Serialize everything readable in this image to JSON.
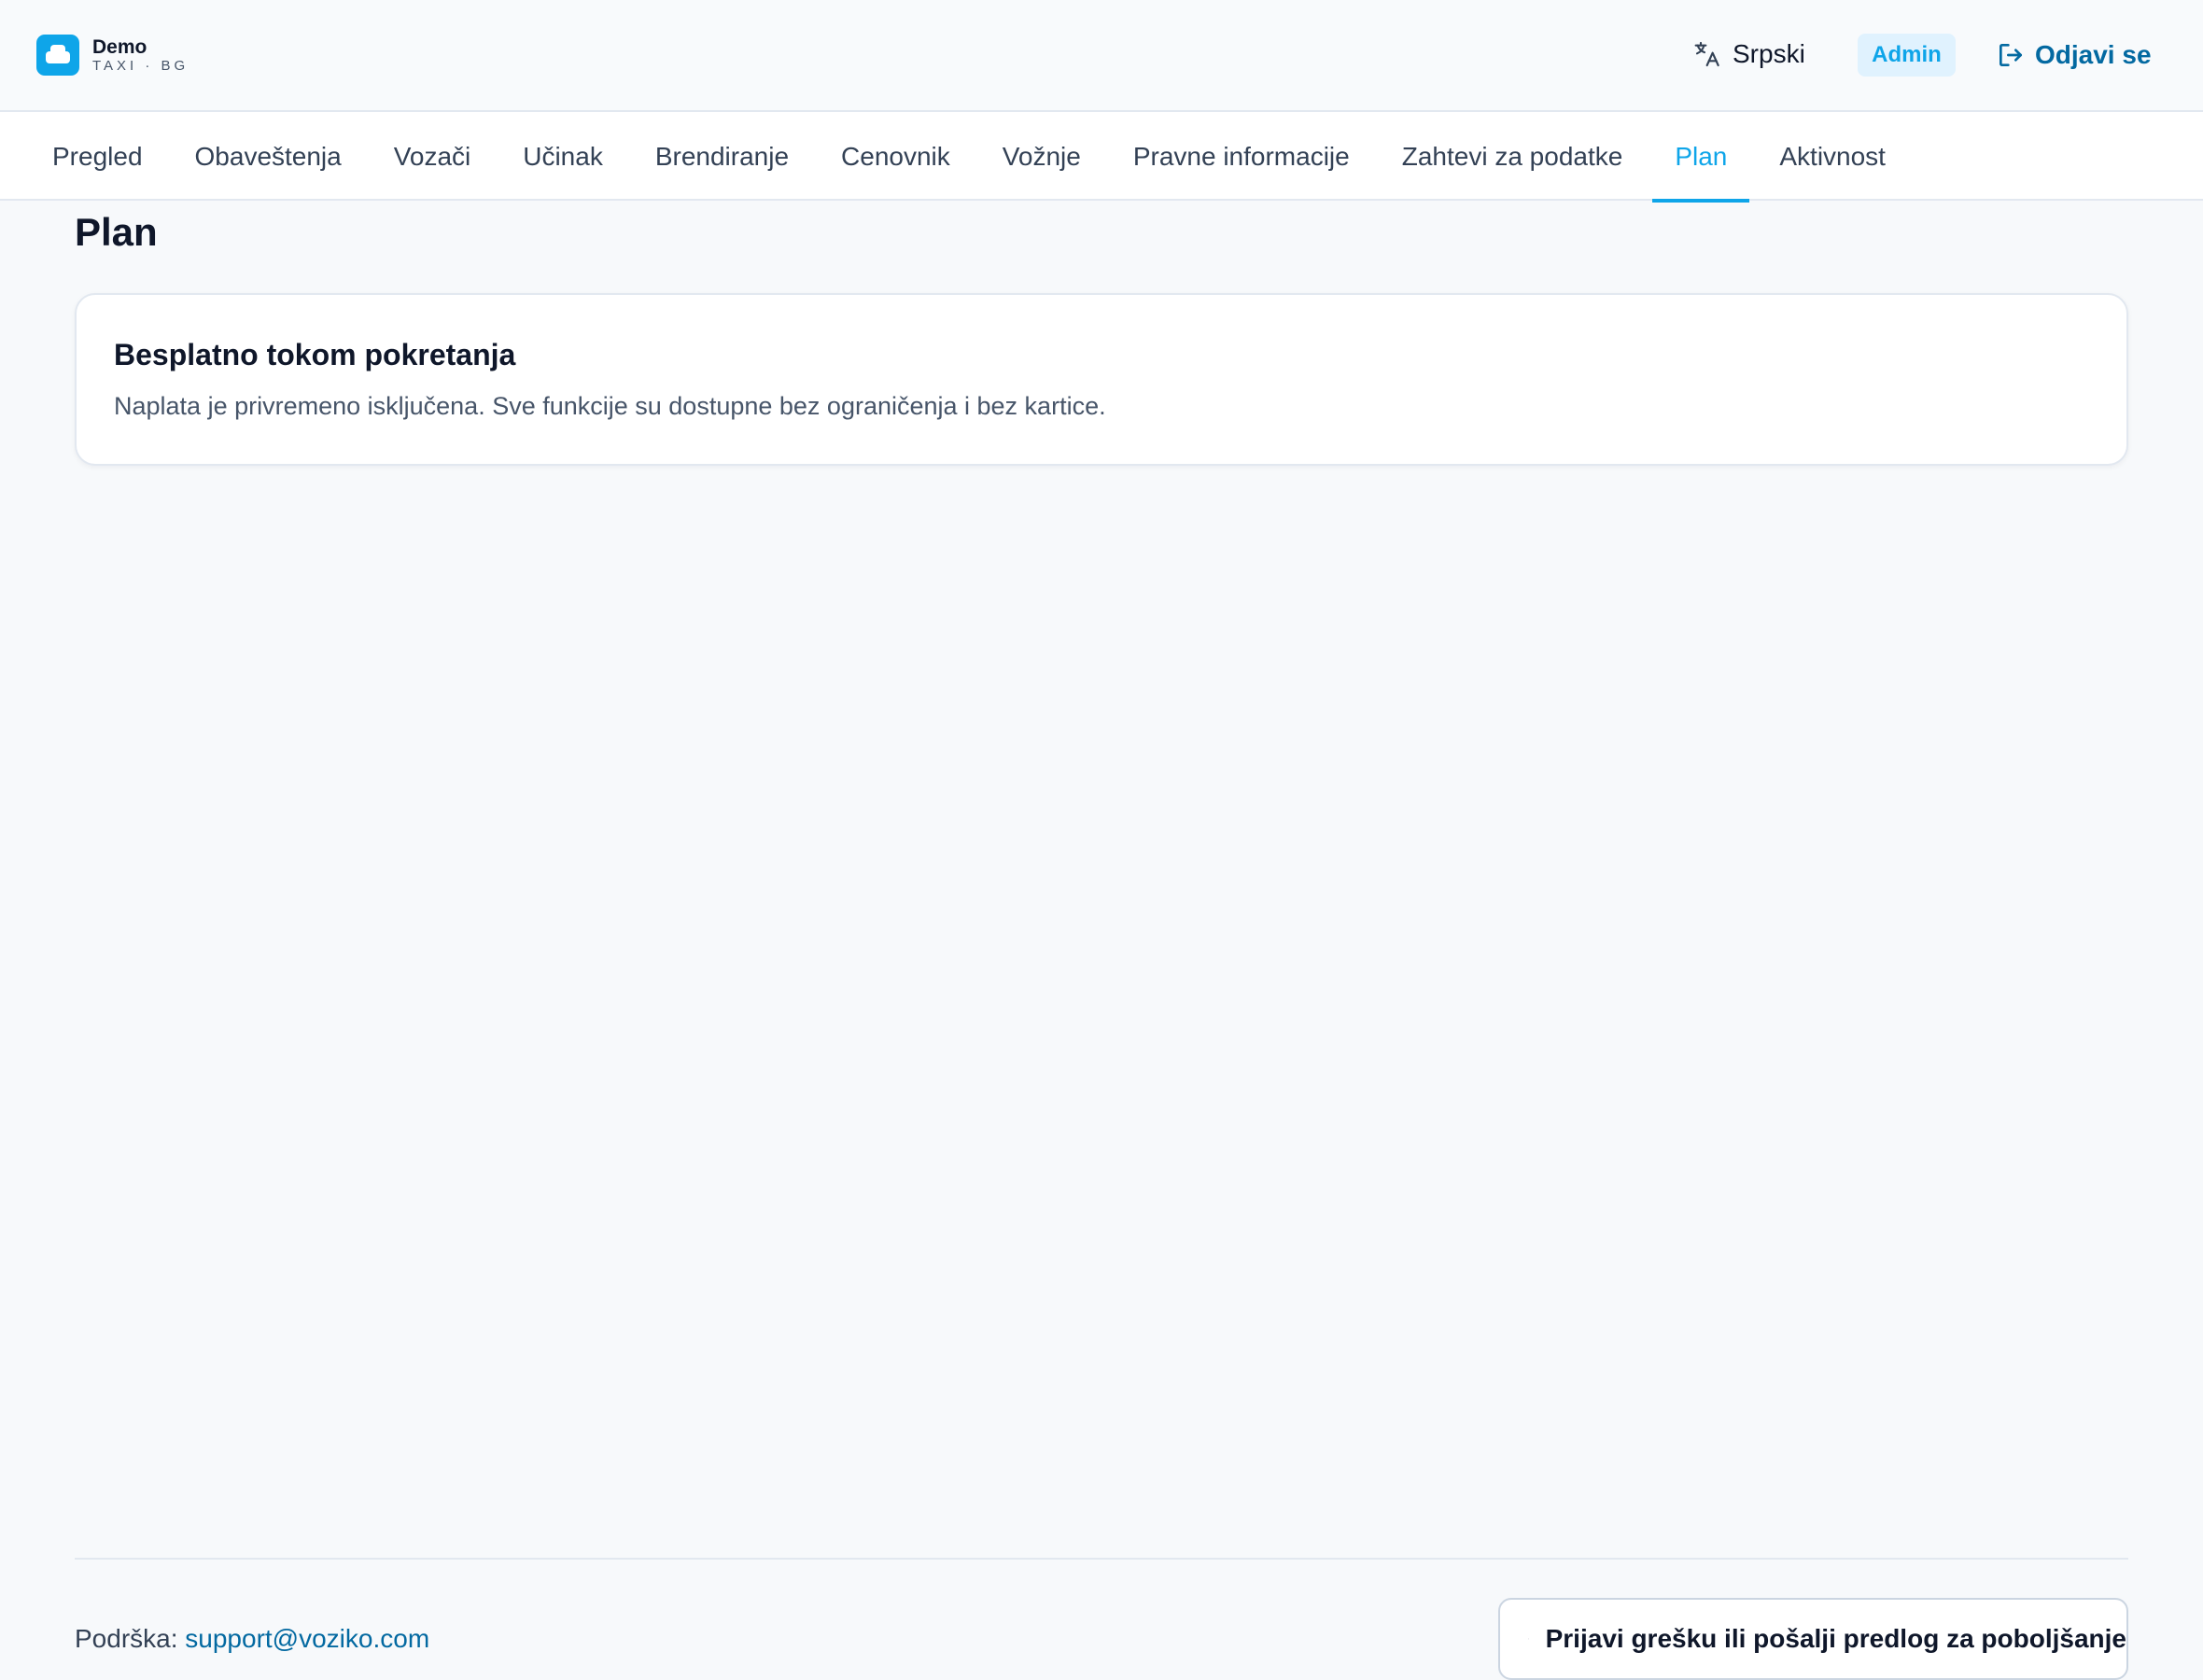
{
  "brand": {
    "name": "Demo",
    "subtitle": "TAXI · BG"
  },
  "header": {
    "language_label": "Srpski",
    "language_icon": "translate-icon",
    "role_badge": "Admin",
    "logout_label": "Odjavi se",
    "logout_icon": "logout-icon"
  },
  "nav": {
    "tabs": [
      {
        "label": "Pregled"
      },
      {
        "label": "Obaveštenja"
      },
      {
        "label": "Vozači"
      },
      {
        "label": "Učinak"
      },
      {
        "label": "Brendiranje"
      },
      {
        "label": "Cenovnik"
      },
      {
        "label": "Vožnje"
      },
      {
        "label": "Pravne informacije"
      },
      {
        "label": "Zahtevi za podatke"
      },
      {
        "label": "Plan"
      },
      {
        "label": "Aktivnost"
      }
    ],
    "active_tab": "Plan"
  },
  "main": {
    "title": "Plan",
    "card": {
      "title": "Besplatno tokom pokretanja",
      "text": "Naplata je privremeno isključena. Sve funkcije su dostupne bez ograničenja i bez kartice."
    }
  },
  "footer": {
    "support_label": "Podrška:",
    "support_email": "support@voziko.com",
    "feedback_label": "Prijavi grešku ili pošalji predlog za poboljšanje",
    "feedback_icon": "message-plus-icon"
  },
  "colors": {
    "accent": "#0ea5e9",
    "link": "#0369a1",
    "background": "#f7f9fb",
    "badge_bg": "#e0f2fe"
  }
}
